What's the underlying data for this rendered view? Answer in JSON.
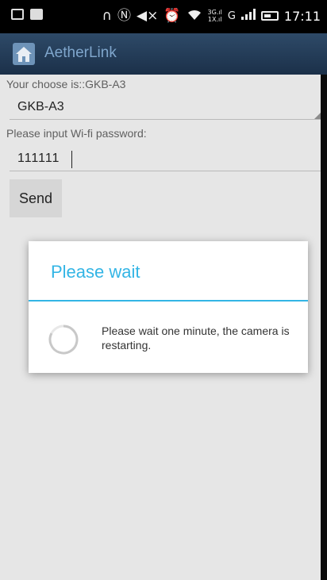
{
  "status_bar": {
    "time": "17:11",
    "icons": [
      "notification-icon",
      "message-icon",
      "headset-icon",
      "nfc-icon",
      "mute-icon",
      "alarm-icon",
      "wifi-icon",
      "signal-3g-icon",
      "signal-g-icon",
      "signal-bars-icon",
      "battery-icon"
    ],
    "tiny_3g": "3G.ıl",
    "tiny_1x": "1X.ıl",
    "network_g": "G"
  },
  "action_bar": {
    "title": "AetherLink"
  },
  "form": {
    "choose_label": "Your choose is::GKB-A3",
    "selected_device": "GKB-A3",
    "password_label": "Please input Wi-fi password:",
    "password_value": "111111",
    "send_label": "Send"
  },
  "dialog": {
    "title": "Please wait",
    "message": "Please wait one minute, the camera is restarting.",
    "accent_color": "#33b5e5"
  }
}
